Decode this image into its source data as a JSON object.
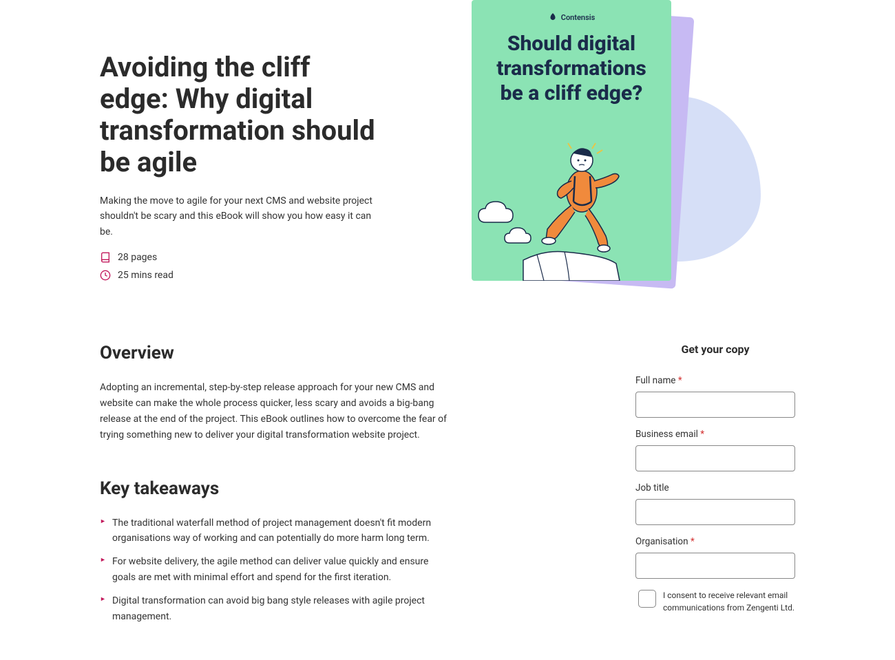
{
  "hero": {
    "title": "Avoiding the cliff edge: Why digital transformation should be agile",
    "subtitle": "Making the move to agile for your next CMS and website project shouldn't be scary and this eBook will show you how easy it can be.",
    "pages": "28 pages",
    "readTime": "25 mins read"
  },
  "cover": {
    "brand": "Contensis",
    "title": "Should digital transformations be a cliff edge?"
  },
  "overview": {
    "heading": "Overview",
    "text": "Adopting an incremental, step-by-step release approach for your new CMS and website can make the whole process quicker, less scary and avoids a big-bang release at the end of the project. This eBook outlines how to overcome the fear of trying something new to deliver your digital transformation website project."
  },
  "takeaways": {
    "heading": "Key takeaways",
    "items": [
      "The traditional waterfall method of project management doesn't fit modern organisations way of working and can potentially do more harm long term.",
      "For website delivery, the agile method can deliver value quickly and ensure goals are met with minimal effort and spend for the first iteration.",
      "Digital transformation can avoid big bang style releases with agile project management."
    ]
  },
  "form": {
    "title": "Get your copy",
    "fields": {
      "fullName": {
        "label": "Full name",
        "required": true
      },
      "email": {
        "label": "Business email",
        "required": true
      },
      "jobTitle": {
        "label": "Job title",
        "required": false
      },
      "organisation": {
        "label": "Organisation",
        "required": true
      }
    },
    "consent": "I consent to receive relevant email communications from Zengenti Ltd."
  }
}
